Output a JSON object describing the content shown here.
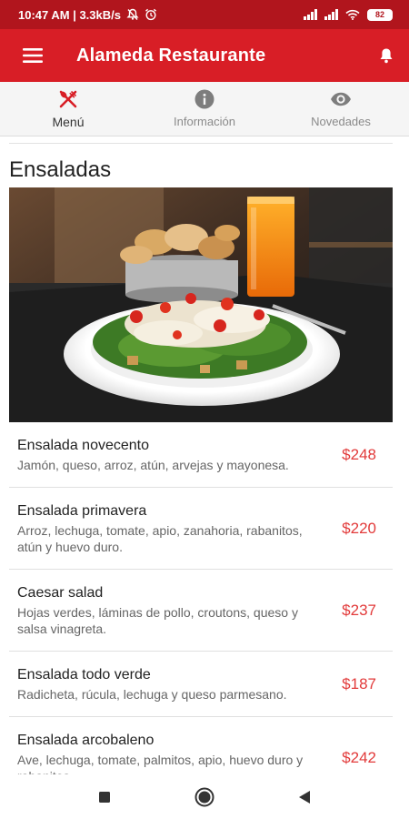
{
  "status_bar": {
    "time_speed": "10:47 AM | 3.3kB/s",
    "battery": "82"
  },
  "app_bar": {
    "title": "Alameda Restaurante"
  },
  "tabs": [
    {
      "label": "Menú",
      "icon": "fork-knife-icon",
      "active": true
    },
    {
      "label": "Información",
      "icon": "info-icon",
      "active": false
    },
    {
      "label": "Novedades",
      "icon": "eye-icon",
      "active": false
    }
  ],
  "section": {
    "title": "Ensaladas"
  },
  "menu_items": [
    {
      "name": "Ensalada novecento",
      "description": "Jamón, queso, arroz, atún, arvejas y mayonesa.",
      "price": "$248"
    },
    {
      "name": "Ensalada primavera",
      "description": "Arroz, lechuga, tomate, apio, zanahoria, rabanitos, atún y huevo duro.",
      "price": "$220"
    },
    {
      "name": "Caesar salad",
      "description": "Hojas verdes, láminas de pollo, croutons, queso y salsa vinagreta.",
      "price": "$237"
    },
    {
      "name": "Ensalada todo verde",
      "description": "Radicheta, rúcula, lechuga y queso parmesano.",
      "price": "$187"
    },
    {
      "name": "Ensalada arcobaleno",
      "description": "Ave, lechuga, tomate, palmitos, apio, huevo duro y rabanitos.",
      "price": "$242"
    }
  ],
  "colors": {
    "primary": "#d81e26",
    "status_bar": "#b1151d",
    "price": "#e23a3a"
  }
}
